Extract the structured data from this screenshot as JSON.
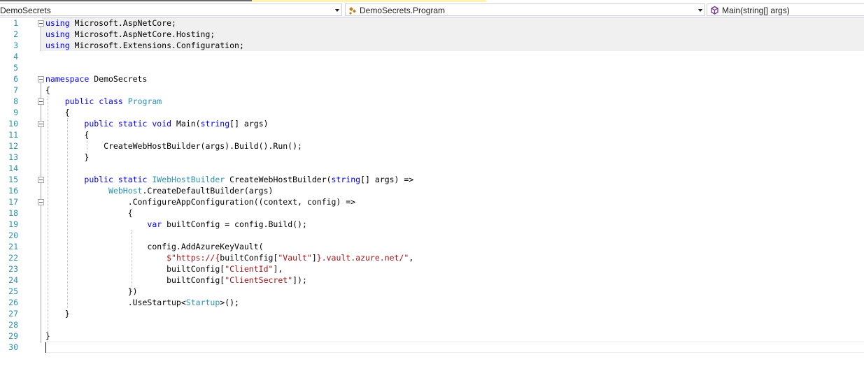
{
  "navbar": {
    "project": "DemoSecrets",
    "class": "DemoSecrets.Program",
    "member": "Main(string[] args)"
  },
  "icons": {
    "class_icon": "class-icon",
    "method_icon": "method-icon",
    "dropdown_arrow": "chevron-down-icon",
    "fold_toggle": "collapse-icon"
  },
  "colors": {
    "keyword": "#0000ff",
    "type": "#2b91af",
    "string": "#a31515",
    "line_number": "#2b91af"
  },
  "editor": {
    "line_numbers": [
      "1",
      "2",
      "3",
      "4",
      "5",
      "6",
      "7",
      "8",
      "9",
      "10",
      "11",
      "12",
      "13",
      "14",
      "15",
      "16",
      "17",
      "18",
      "19",
      "20",
      "21",
      "22",
      "23",
      "24",
      "25",
      "26",
      "27",
      "28",
      "29",
      "30"
    ],
    "lines": [
      "using Microsoft.AspNetCore;",
      "using Microsoft.AspNetCore.Hosting;",
      "using Microsoft.Extensions.Configuration;",
      "",
      "",
      "namespace DemoSecrets",
      "{",
      "    public class Program",
      "    {",
      "        public static void Main(string[] args)",
      "        {",
      "            CreateWebHostBuilder(args).Build().Run();",
      "        }",
      "",
      "        public static IWebHostBuilder CreateWebHostBuilder(string[] args) =>",
      "             WebHost.CreateDefaultBuilder(args)",
      "                 .ConfigureAppConfiguration((context, config) =>",
      "                 {",
      "                     var builtConfig = config.Build();",
      "",
      "                     config.AddAzureKeyVault(",
      "                         $\"https://{builtConfig[\"Vault\"]}.vault.azure.net/\",",
      "                         builtConfig[\"ClientId\"],",
      "                         builtConfig[\"ClientSecret\"]);",
      "                 })",
      "                 .UseStartup<Startup>();",
      "    }",
      "",
      "}",
      ""
    ]
  }
}
